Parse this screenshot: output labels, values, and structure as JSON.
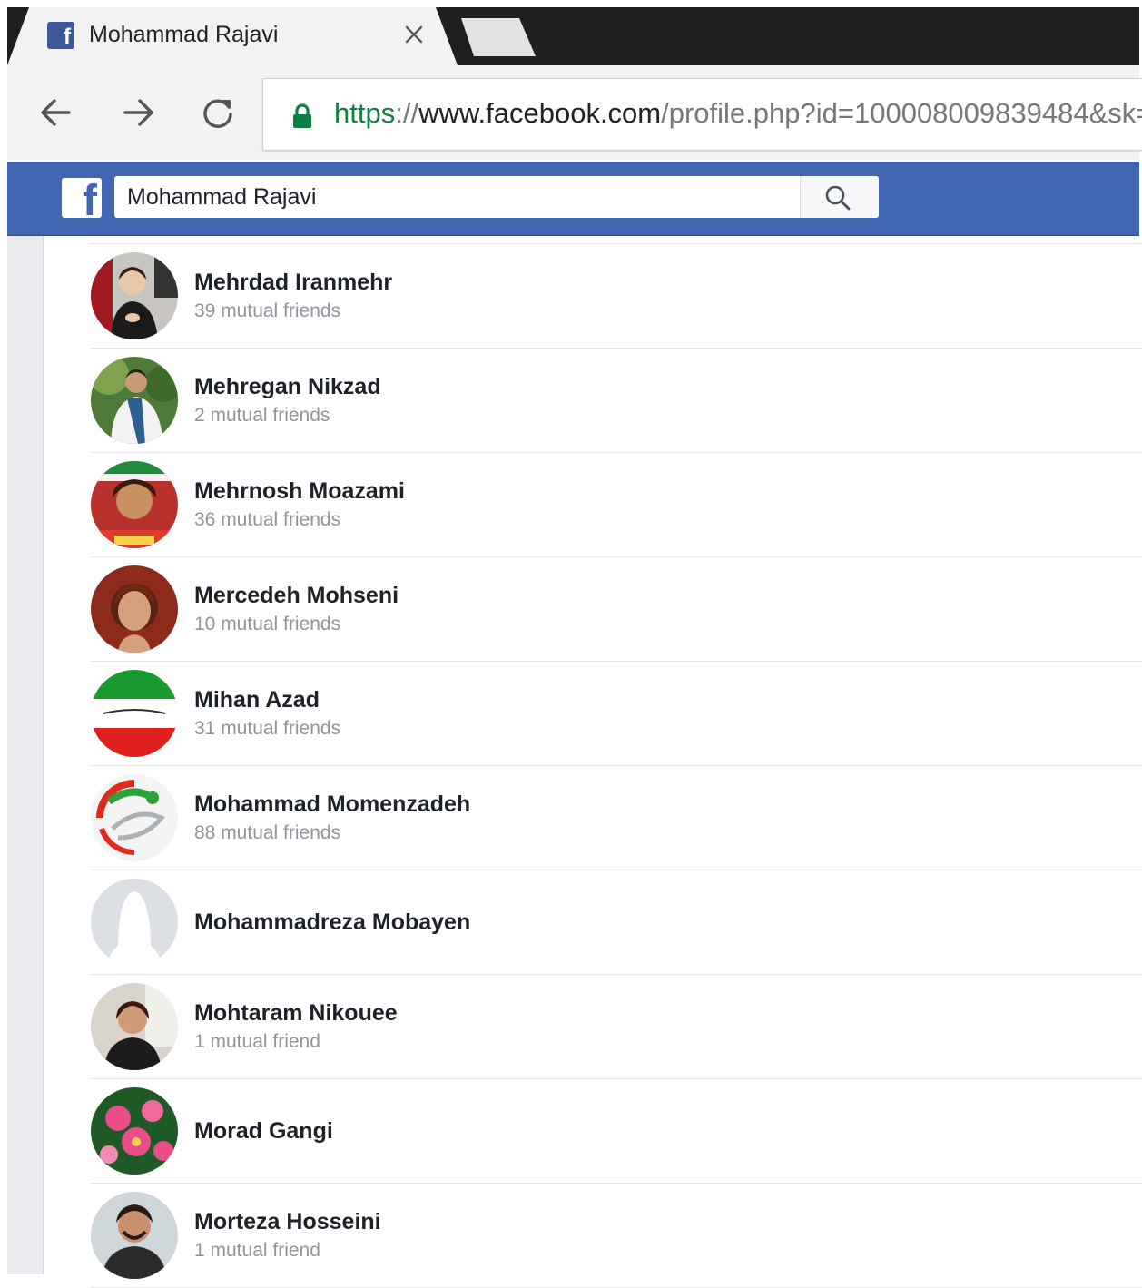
{
  "browser": {
    "tab_title": "Mohammad Rajavi",
    "url_scheme": "https",
    "url_sep": "://",
    "url_host": "www.facebook.com",
    "url_path": "/profile.php?id=100008009839484&sk="
  },
  "facebook": {
    "search_value": "Mohammad Rajavi",
    "brand_color": "#4267b2"
  },
  "friends": [
    {
      "name": "Mehrdad Iranmehr",
      "mutual": "39 mutual friends"
    },
    {
      "name": "Mehregan Nikzad",
      "mutual": "2 mutual friends"
    },
    {
      "name": "Mehrnosh Moazami",
      "mutual": "36 mutual friends"
    },
    {
      "name": "Mercedeh Mohseni",
      "mutual": "10 mutual friends"
    },
    {
      "name": "Mihan Azad",
      "mutual": "31 mutual friends"
    },
    {
      "name": "Mohammad Momenzadeh",
      "mutual": "88 mutual friends"
    },
    {
      "name": "Mohammadreza Mobayen",
      "mutual": ""
    },
    {
      "name": "Mohtaram Nikouee",
      "mutual": "1 mutual friend"
    },
    {
      "name": "Morad Gangi",
      "mutual": ""
    },
    {
      "name": "Morteza Hosseini",
      "mutual": "1 mutual friend"
    }
  ]
}
